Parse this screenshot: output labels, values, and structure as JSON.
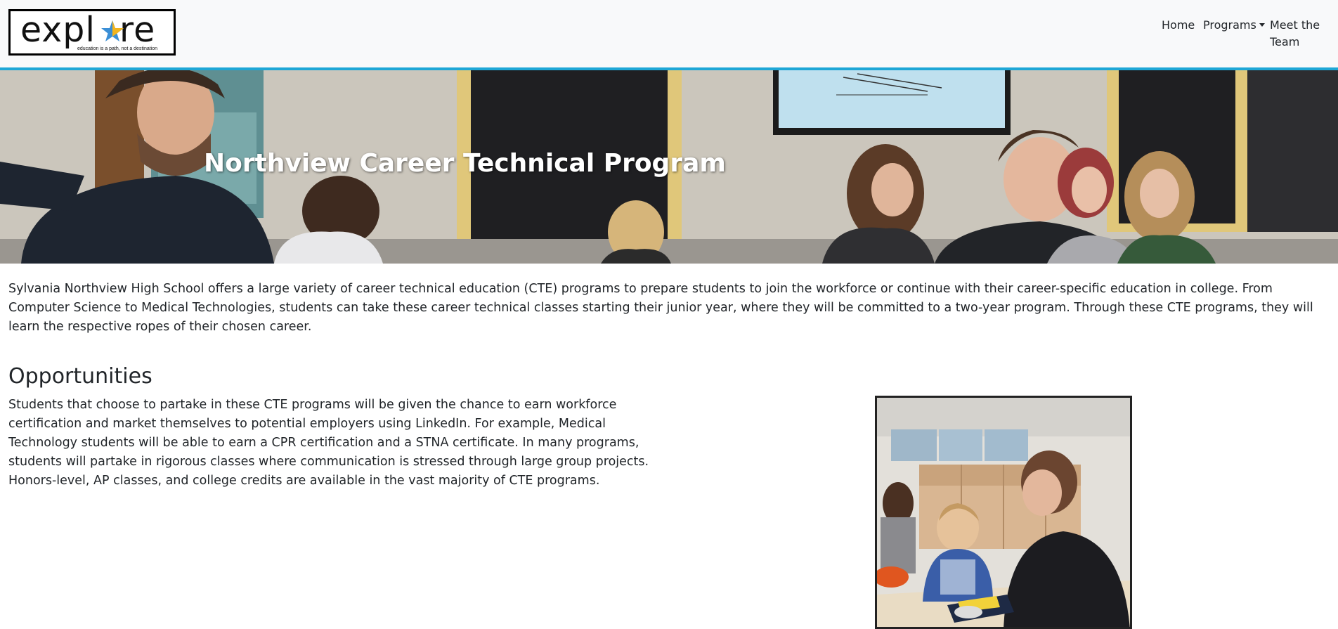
{
  "navbar": {
    "logo": {
      "word_left": "expl",
      "word_right": "re",
      "tagline": "education is a path, not a destination"
    },
    "links": {
      "home": "Home",
      "programs": "Programs",
      "meet_team": "Meet the Team"
    },
    "accent_color": "#1ea7d6"
  },
  "hero": {
    "title": "Northview Career Technical Program"
  },
  "intro": {
    "text": "Sylvania Northview High School offers a large variety of career technical education (CTE) programs to prepare students to join the workforce or continue with their career-specific education in college. From Computer Science to Medical Technologies, students can take these career technical classes starting their junior year, where they will be committed to a two-year program. Through these CTE programs, they will learn the respective ropes of their chosen career."
  },
  "opportunities": {
    "heading": "Opportunities",
    "text": "Students that choose to partake in these CTE programs will be given the chance to earn workforce certification and market themselves to potential employers using LinkedIn. For example, Medical Technology students will be able to earn a CPR certification and a STNA certificate. In many programs, students will partake in rigorous classes where communication is stressed through large group projects. Honors-level, AP classes, and college credits are available in the vast majority of CTE programs."
  }
}
